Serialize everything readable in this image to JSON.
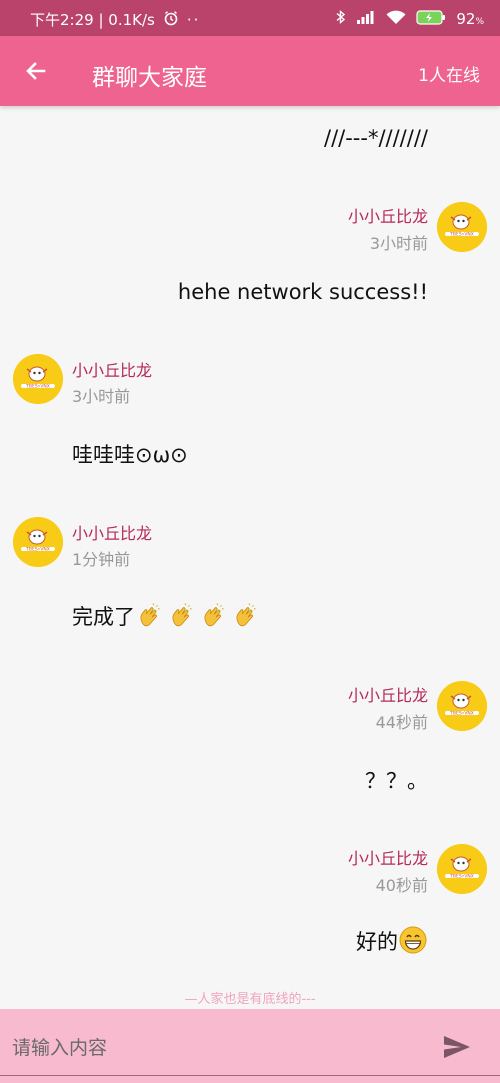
{
  "status_bar": {
    "time_speed": "下午2:29 | 0.1K/s",
    "dots": "··",
    "battery": "92"
  },
  "app_bar": {
    "title": "群聊大家庭",
    "online": "1人在线"
  },
  "messages": [
    {
      "side": "right",
      "text": "///---*///////"
    },
    {
      "side": "right",
      "sender": "小小丘比龙",
      "time": "3小时前",
      "text": "hehe network success!!"
    },
    {
      "side": "left",
      "sender": "小小丘比龙",
      "time": "3小时前",
      "text": "哇哇哇⊙ω⊙"
    },
    {
      "side": "left",
      "sender": "小小丘比龙",
      "time": "1分钟前",
      "text": "完成了",
      "emoji": "clapping-hands-emoji"
    },
    {
      "side": "right",
      "sender": "小小丘比龙",
      "time": "44秒前",
      "text": "？？。"
    },
    {
      "side": "right",
      "sender": "小小丘比龙",
      "time": "40秒前",
      "text": "好的",
      "emoji": "grinning-face-emoji"
    }
  ],
  "footer_note": "—人家也是有底线的---",
  "input": {
    "placeholder": "请输入内容",
    "value": ""
  },
  "colors": {
    "status_bar": "#b9436a",
    "app_bar": "#ee6390",
    "sender": "#b6295a",
    "input_bar": "#f8bace",
    "avatar": "#f8cc16"
  }
}
